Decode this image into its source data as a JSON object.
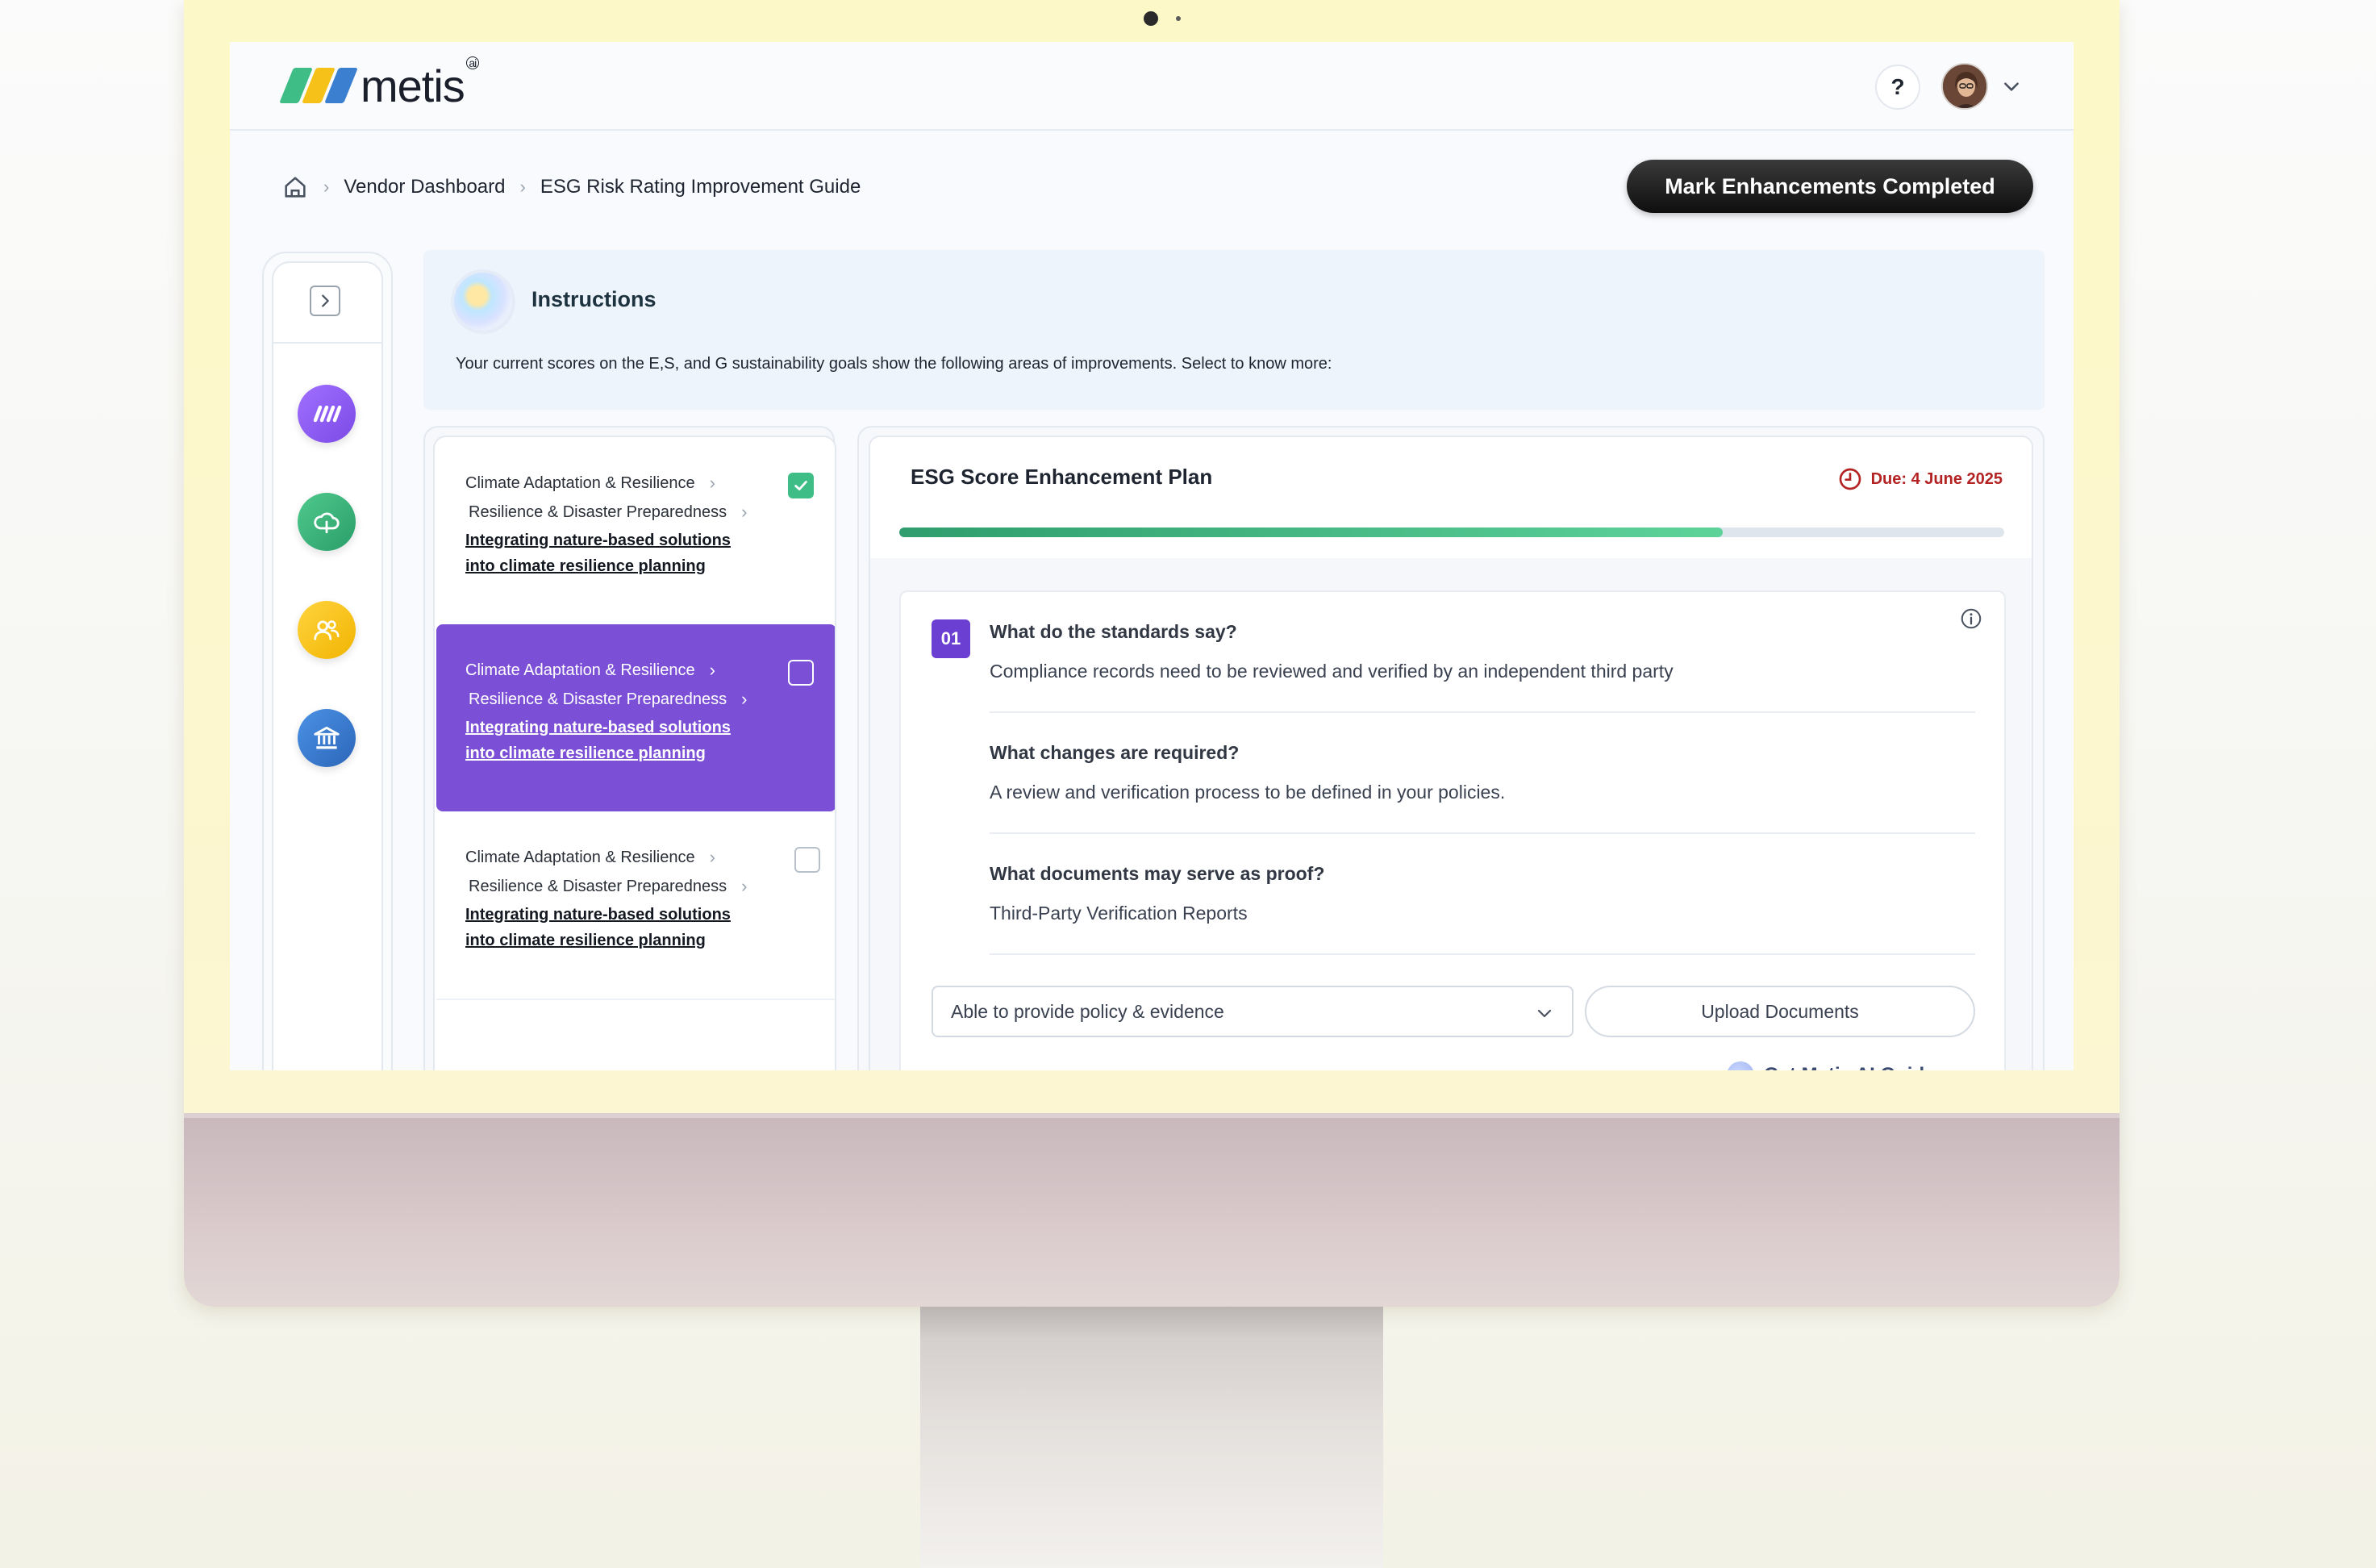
{
  "app": {
    "logo_text": "metis",
    "logo_badge": "ai",
    "help_label": "?"
  },
  "colors": {
    "brand_purple": "#7b4fd6",
    "success_green": "#3fbd86",
    "due_red": "#b42323",
    "rail_purple": "#8e5cf0",
    "rail_green": "#3bb37e",
    "rail_yellow": "#f6c21a",
    "rail_blue": "#3a7fd0"
  },
  "breadcrumb": {
    "home_icon": "home-icon",
    "items": [
      "Vendor Dashboard",
      "ESG Risk Rating Improvement Guide"
    ]
  },
  "header": {
    "mark_button": "Mark Enhancements Completed"
  },
  "sidebar": {
    "icons": [
      "metis-icon",
      "environment-icon",
      "social-icon",
      "governance-icon"
    ]
  },
  "instructions": {
    "title": "Instructions",
    "text": "Your current scores on the E,S, and G sustainability goals show the following areas of improvements. Select to know more:"
  },
  "list": {
    "items": [
      {
        "category": "Climate Adaptation & Resilience",
        "subcategory": "Resilience & Disaster Preparedness",
        "link": "Integrating nature-based solutions into climate resilience planning",
        "checked": true,
        "active": false
      },
      {
        "category": "Climate Adaptation & Resilience",
        "subcategory": "Resilience & Disaster Preparedness",
        "link": "Integrating nature-based solutions into climate resilience planning",
        "checked": false,
        "active": true
      },
      {
        "category": "Climate Adaptation & Resilience",
        "subcategory": "Resilience & Disaster Preparedness",
        "link": "Integrating nature-based solutions into climate resilience planning",
        "checked": false,
        "active": false
      }
    ]
  },
  "plan": {
    "title": "ESG Score Enhancement Plan",
    "due": "Due: 4 June 2025",
    "progress_fraction": 0.745,
    "step_number": "01",
    "questions": [
      {
        "q": "What do the standards say?",
        "a": "Compliance records need to be reviewed and verified by an independent third party"
      },
      {
        "q": "What changes are required?",
        "a": "A review and verification process to be defined in your policies."
      },
      {
        "q": "What documents may serve as proof?",
        "a": "Third-Party Verification Reports"
      }
    ],
    "select_value": "Able to provide policy & evidence",
    "upload_label": "Upload Documents",
    "ai_guidance": "Get Metis AI Guidance"
  }
}
